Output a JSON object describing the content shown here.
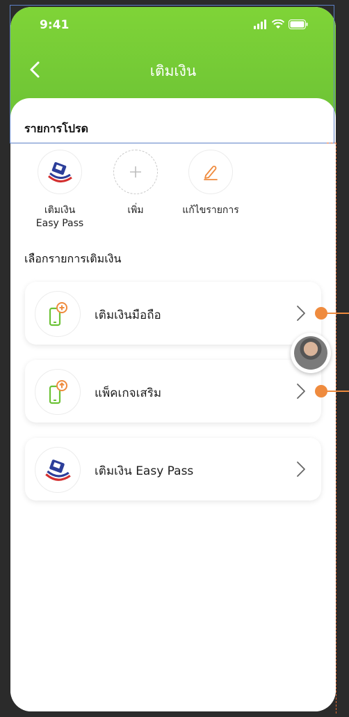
{
  "status_bar": {
    "time": "9:41"
  },
  "header": {
    "title": "เติมเงิน"
  },
  "favorites": {
    "section_title": "รายการโปรด",
    "items": [
      {
        "label_line1": "เติมเงิน",
        "label_line2": "Easy Pass",
        "icon": "easy-pass-logo-icon"
      },
      {
        "label_line1": "เพิ่ม",
        "label_line2": "",
        "icon": "plus-icon"
      },
      {
        "label_line1": "แก้ไขรายการ",
        "label_line2": "",
        "icon": "pencil-edit-icon"
      }
    ]
  },
  "topup": {
    "section_title": "เลือกรายการเติมเงิน",
    "items": [
      {
        "label": "เติมเงินมือถือ",
        "icon": "mobile-topup-icon"
      },
      {
        "label": "แพ็คเกจเสริม",
        "icon": "mobile-package-icon"
      },
      {
        "label": "เติมเงิน Easy Pass",
        "icon": "easy-pass-logo-icon"
      }
    ]
  },
  "colors": {
    "header_green": "#6cc236",
    "accent_orange": "#ef8b3e",
    "annotation_blue": "#5d80c6"
  }
}
